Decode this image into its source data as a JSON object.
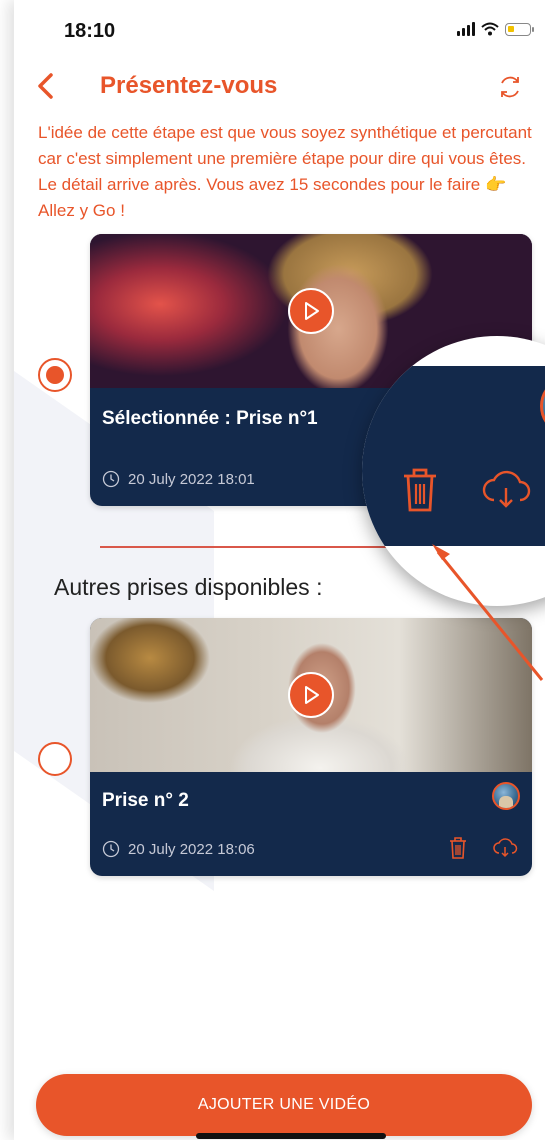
{
  "status_bar": {
    "time": "18:10"
  },
  "header": {
    "title": "Présentez-vous"
  },
  "intro": {
    "text_before_emoji": "L'idée de cette étape est que vous soyez synthétique et percutant car c'est simplement une première étape pour dire qui vous êtes. Le détail arrive après. Vous avez 15 secondes pour le faire",
    "emoji": "👉",
    "text_after_emoji": "Allez y Go !"
  },
  "selected_take": {
    "title": "Sélectionnée : Prise n°1",
    "date": "20 July 2022 18:01",
    "selected": true
  },
  "other_takes_title": "Autres prises disponibles :",
  "other_takes": [
    {
      "title": "Prise n° 2",
      "date": "20 July 2022 18:06",
      "selected": false
    }
  ],
  "add_button": {
    "label": "AJOUTER UNE VIDÉO"
  },
  "colors": {
    "accent": "#e8552a",
    "card_bg": "#13294b",
    "text": "#222222"
  },
  "icons": [
    "back-chevron-icon",
    "refresh-icon",
    "play-icon",
    "clock-icon",
    "trash-icon",
    "cloud-download-icon"
  ]
}
